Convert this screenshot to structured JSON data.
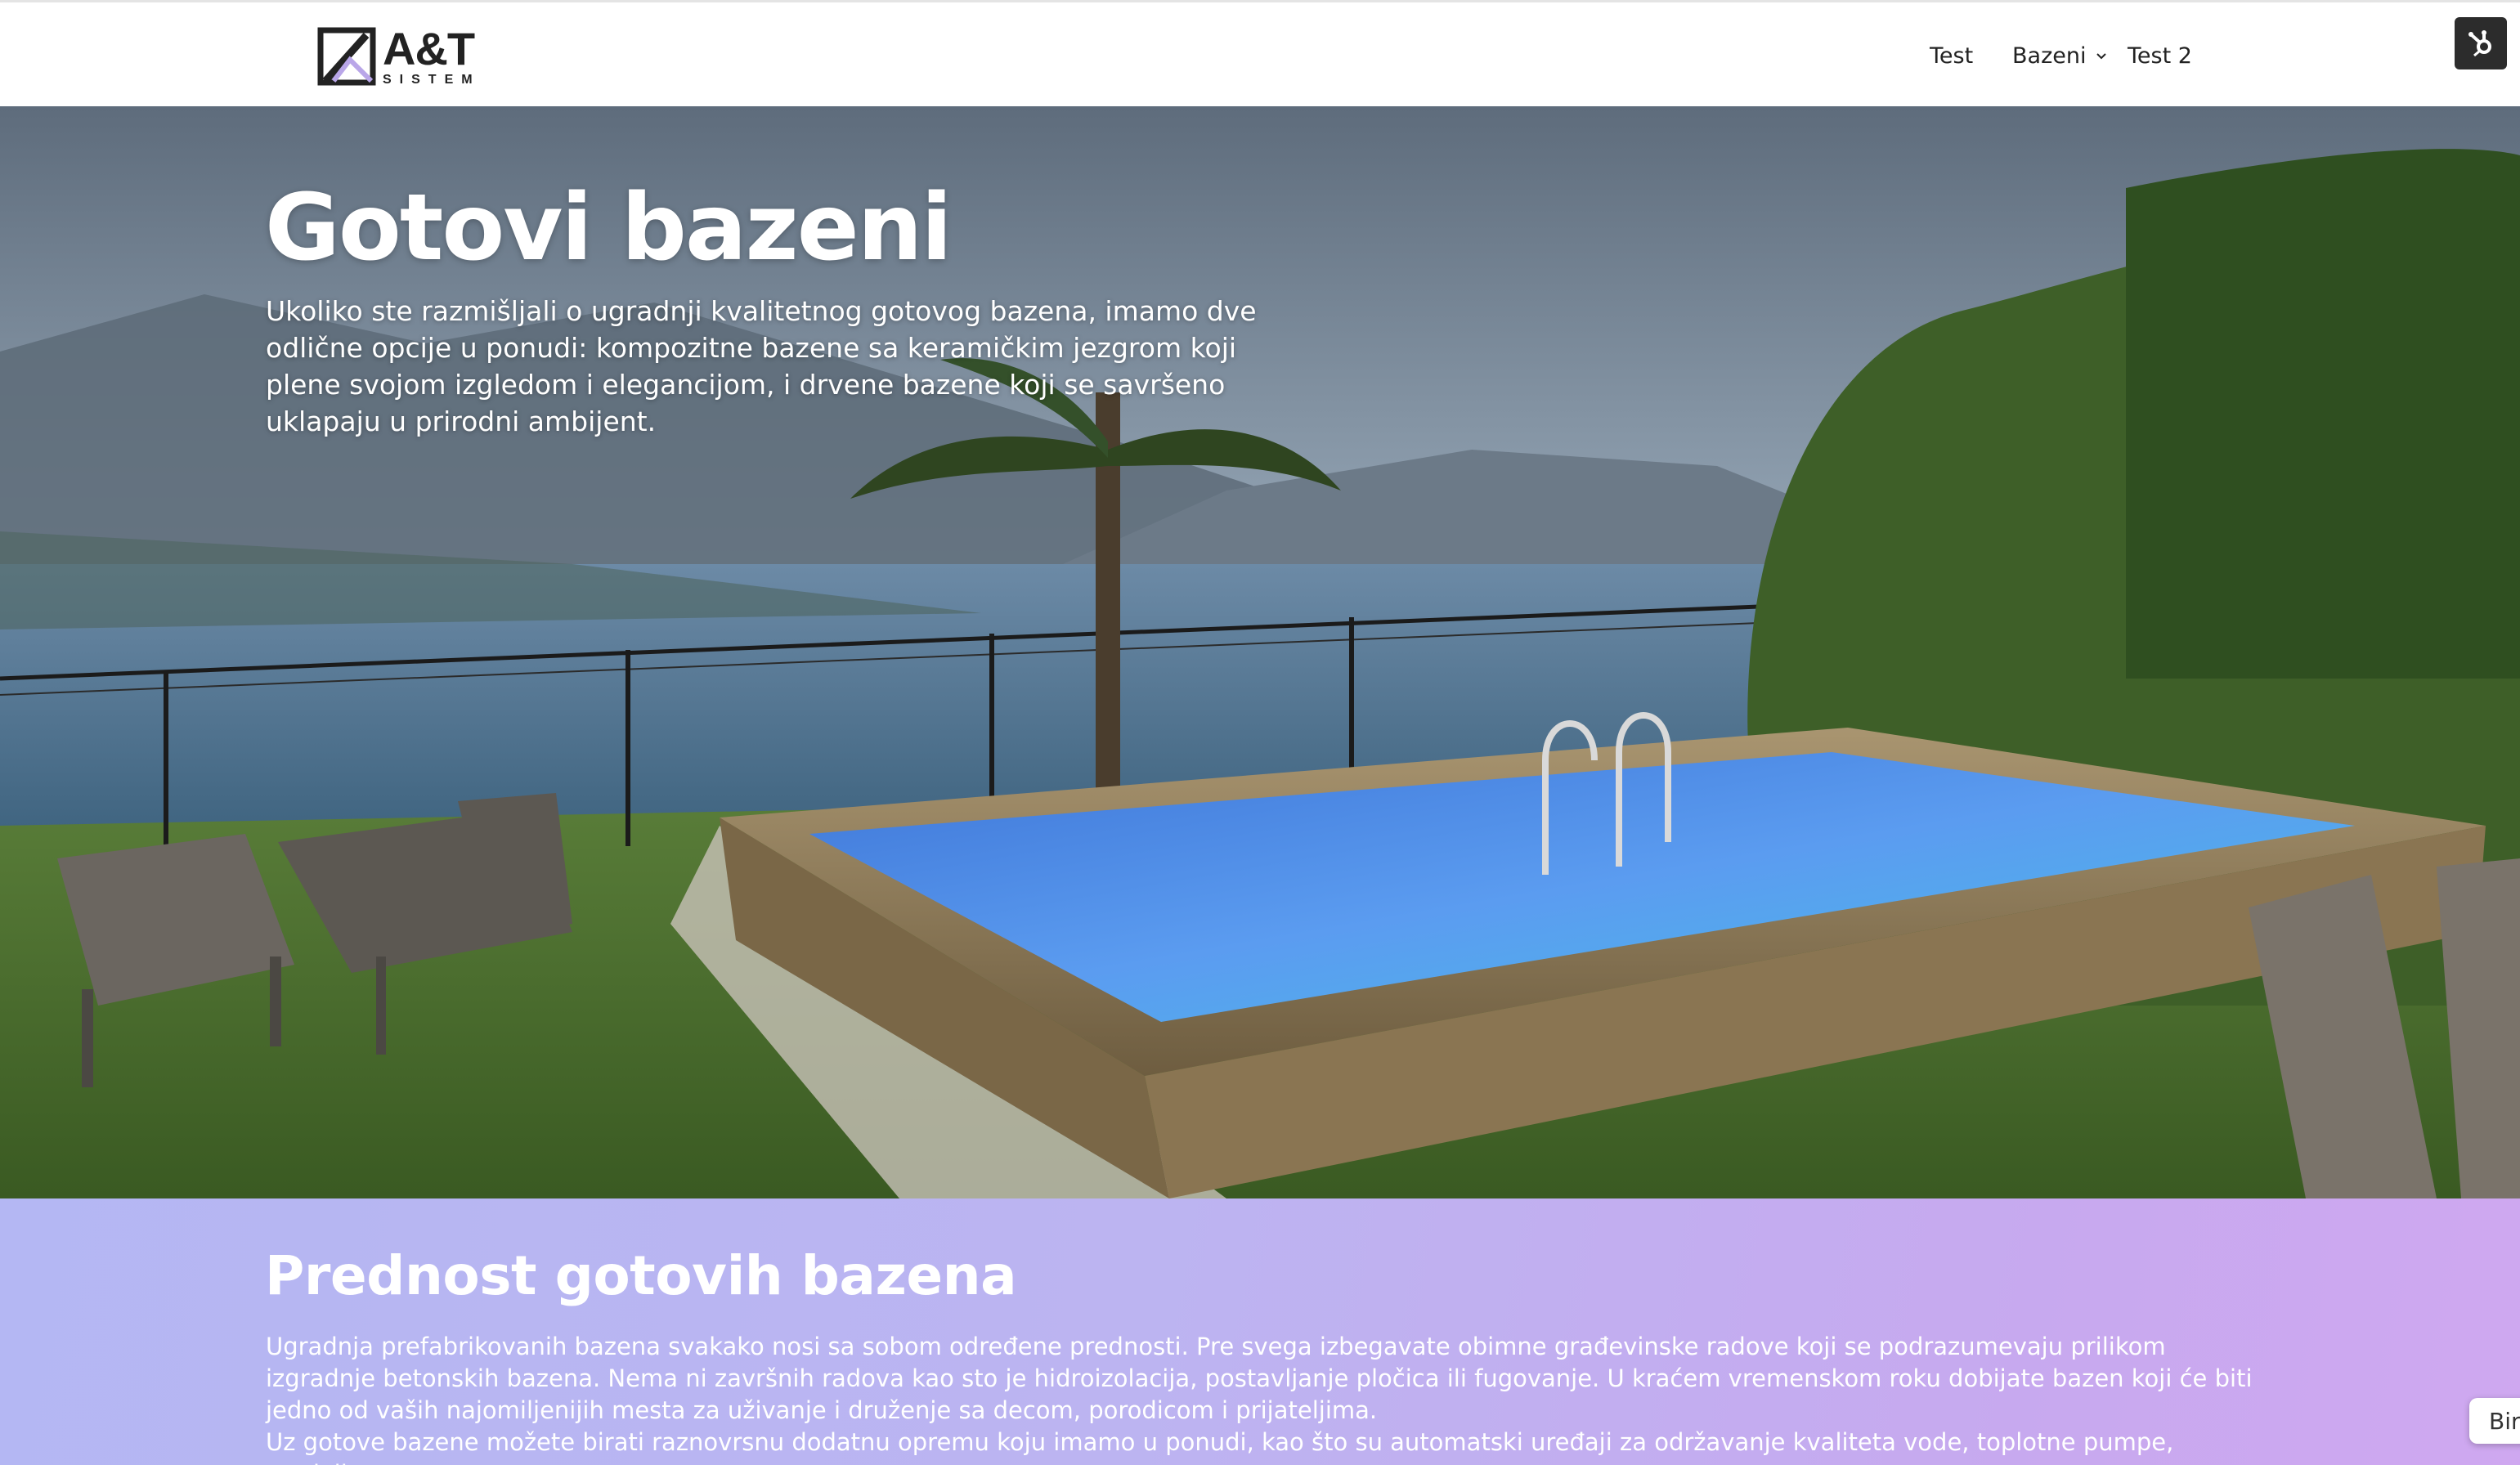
{
  "header": {
    "logo": {
      "main": "A&T",
      "sub": "SISTEM"
    },
    "nav": {
      "test": "Test",
      "bazeni": "Bazeni",
      "test2": "Test 2"
    },
    "hub_icon": "hubspot-icon"
  },
  "hero": {
    "title": "Gotovi bazeni",
    "text": "Ukoliko ste razmišljali o ugradnji kvalitetnog gotovog bazena, imamo dve odlične opcije u ponudi: kompozitne bazene sa keramičkim jezgrom koji plene svojom izgledom i elegancijom, i drvene bazene koji se savršeno uklapaju u prirodni ambijent."
  },
  "advantages": {
    "title": "Prednost gotovih bazena",
    "paragraph1": "Ugradnja prefabrikovanih bazena svakako nosi sa sobom određene prednosti. Pre svega izbegavate obimne građevinske radove koji se podrazumevaju prilikom izgradnje betonskih bazena. Nema ni završnih radova kao sto je hidroizolacija, postavljanje pločica ili fugovanje. U kraćem vremenskom roku dobijate bazen koji će biti jedno od vaših najomiljenijih mesta za uživanje i druženje sa decom, porodicom i prijateljima.",
    "paragraph2": "Uz gotove bazene možete birati raznovrsnu dodatnu opremu koju imamo u ponudi, kao što su automatski uređaji za održavanje kvaliteta vode, toplotne pumpe, uređaji"
  },
  "chat_tab": {
    "label": "Bir"
  },
  "colors": {
    "section_gradient_start": "#b4b7f3",
    "section_gradient_end": "#cfa8f0",
    "header_bg": "#ffffff",
    "hub_bg": "#2c2c2c"
  }
}
